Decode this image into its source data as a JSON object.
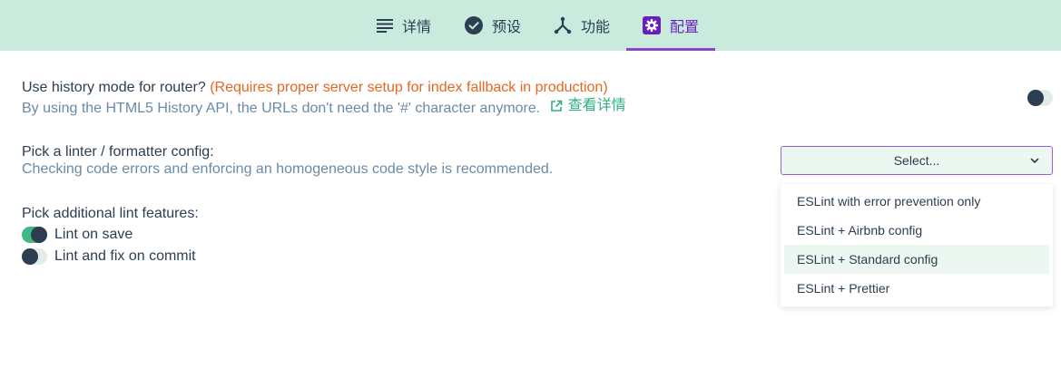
{
  "tabs": [
    {
      "label": "详情",
      "icon": "details-list-icon"
    },
    {
      "label": "预设",
      "icon": "check-circle-icon"
    },
    {
      "label": "功能",
      "icon": "fork-icon"
    },
    {
      "label": "配置",
      "icon": "gear-icon",
      "active": true
    }
  ],
  "history": {
    "title": "Use history mode for router?",
    "warning": "(Requires proper server setup for index fallback in production)",
    "description": "By using the HTML5 History API, the URLs don't need the '#' character anymore.",
    "more_link": "查看详情",
    "enabled": false
  },
  "linter": {
    "title": "Pick a linter / formatter config:",
    "description": "Checking code errors and enforcing an homogeneous code style is recommended.",
    "select_placeholder": "Select...",
    "options": [
      "ESLint with error prevention only",
      "ESLint + Airbnb config",
      "ESLint + Standard config",
      "ESLint + Prettier"
    ],
    "hovered_option": "ESLint + Standard config"
  },
  "lint_features": {
    "title": "Pick additional lint features:",
    "items": [
      {
        "label": "Lint on save",
        "checked": true
      },
      {
        "label": "Lint and fix on commit",
        "checked": false
      }
    ]
  },
  "colors": {
    "tabbar_bg": "#c8ebde",
    "accent_purple": "#8e44c8",
    "accent_green": "#42b983",
    "warning_orange": "#e8661f"
  }
}
